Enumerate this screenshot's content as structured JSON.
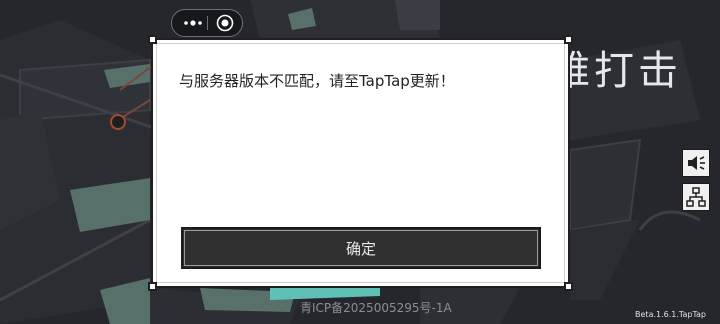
{
  "top_capsule": {
    "more_icon": "more-dots-icon",
    "close_icon": "target-circle-icon"
  },
  "background": {
    "title_fragment": "难打击"
  },
  "side_buttons": [
    {
      "icon": "speaker-icon"
    },
    {
      "icon": "network-tree-icon"
    }
  ],
  "dialog": {
    "message": "与服务器版本不匹配，请至TapTap更新！",
    "confirm_label": "确定"
  },
  "footer": {
    "icp": "青ICP备2025005295号-1A",
    "version": "Beta.1.6.1.TapTap"
  },
  "colors": {
    "background": "#24262b",
    "dialog_bg": "#ffffff",
    "button_bg": "#303030"
  }
}
